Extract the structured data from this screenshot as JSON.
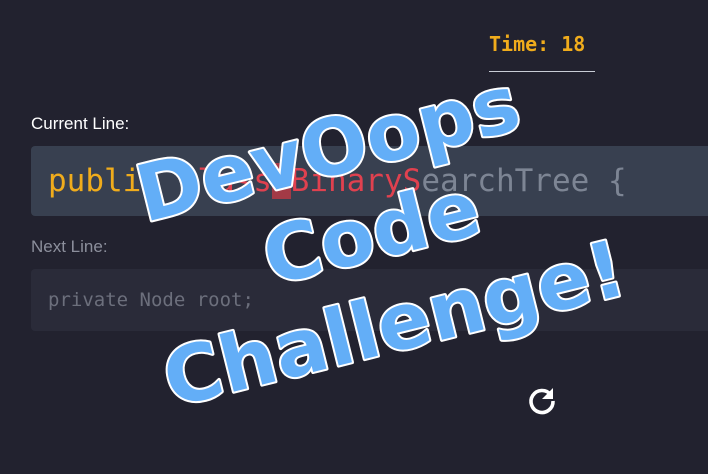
{
  "timer": {
    "text": "Time: 18"
  },
  "current_line": {
    "label": "Current Line:",
    "typed_correct": "public ",
    "typed_wrong": "class",
    "cursor_char": " ",
    "typed_wrong_after": "BinaryS",
    "remaining": "earchTree {"
  },
  "next_line": {
    "label": "Next Line:",
    "code": "private Node root;"
  },
  "overlay_title": {
    "line1": "DevOops",
    "line2": "Code",
    "line3": "Challenge!"
  },
  "colors": {
    "background": "#22222f",
    "accent": "#f0ac1c",
    "error": "#e0414f",
    "title_fill": "#63aef7"
  },
  "icons": {
    "refresh": "refresh-icon"
  }
}
